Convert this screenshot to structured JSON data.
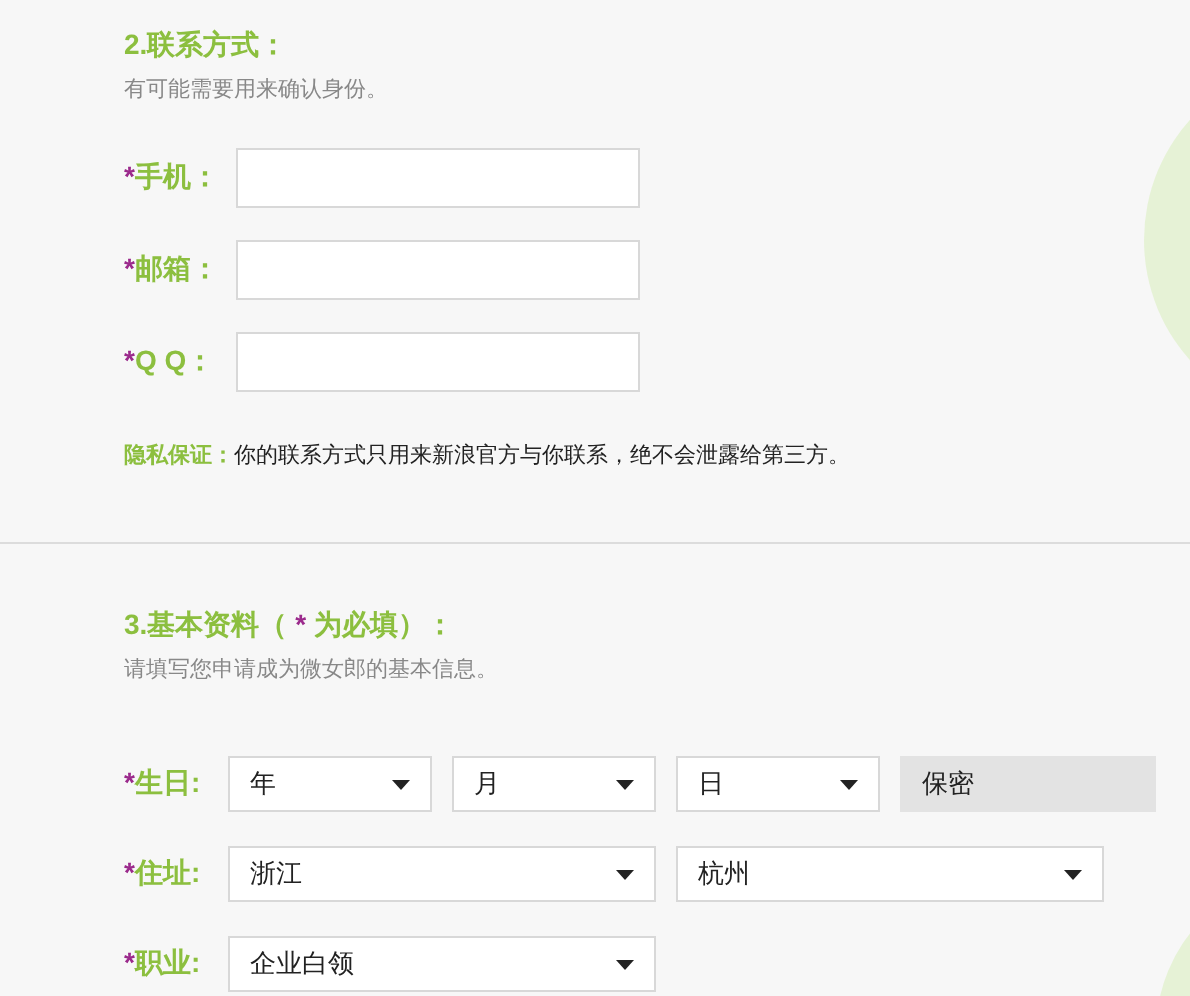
{
  "contact": {
    "title": "2.联系方式：",
    "subtitle": "有可能需要用来确认身份。",
    "fields": [
      {
        "mark": "*",
        "label": "手机："
      },
      {
        "mark": "*",
        "label": "邮箱："
      },
      {
        "mark": "*",
        "label": "Q Q："
      }
    ],
    "note_label": "隐私保证：",
    "note_text": "你的联系方式只用来新浪官方与你联系，绝不会泄露给第三方。"
  },
  "basic": {
    "title": "3.基本资料（",
    "title_mark": "*",
    "title_end": "为必填）：",
    "subtitle": "请填写您申请成为微女郎的基本信息。",
    "rows": [
      {
        "mark": "*",
        "label": "生日:",
        "controls": [
          {
            "kind": "select",
            "value": "年"
          },
          {
            "kind": "select",
            "value": "月"
          },
          {
            "kind": "select",
            "value": "日"
          },
          {
            "kind": "static",
            "value": "保密"
          }
        ]
      },
      {
        "mark": "*",
        "label": "住址:",
        "controls": [
          {
            "kind": "select",
            "value": "浙江"
          },
          {
            "kind": "select",
            "value": "杭州"
          }
        ]
      },
      {
        "mark": "*",
        "label": "职业:",
        "controls": [
          {
            "kind": "select",
            "value": "企业白领"
          }
        ]
      }
    ]
  }
}
